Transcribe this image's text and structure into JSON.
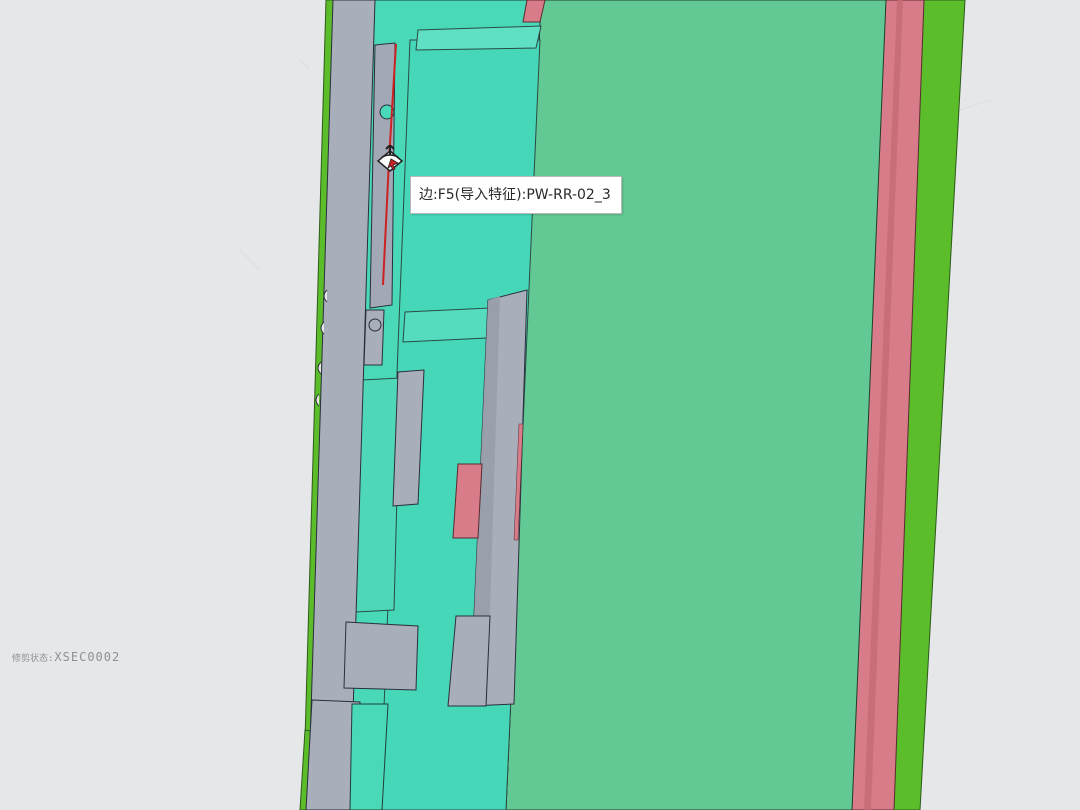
{
  "tooltip": {
    "text": "边:F5(导入特征):PW-RR-02_3"
  },
  "status": {
    "label": "修剪状态:",
    "value": "XSEC0002"
  },
  "colors": {
    "background": "#e6e7e9",
    "green_edge": "#5bbd2a",
    "teal_body": "#49d9b8",
    "mint_face": "#63c994",
    "gray_rib": "#a9aebb",
    "pink_face": "#d77c88",
    "highlight_edge": "#cc2222"
  },
  "icons": {
    "cursor": "select-cursor-icon"
  }
}
